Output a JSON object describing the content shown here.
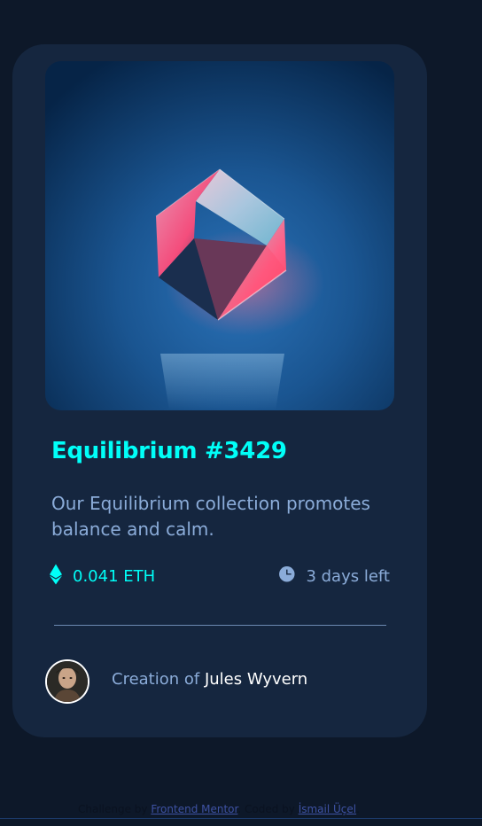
{
  "card": {
    "title": "Equilibrium #3429",
    "description": "Our Equilibrium collection promotes balance and calm.",
    "price": "0.041 ETH",
    "time_left": "3 days left",
    "creator_prefix": "Creation of",
    "creator_name": "Jules Wyvern"
  },
  "attribution": {
    "challenge_prefix": "Challenge by",
    "challenge_link": "Frontend Mentor",
    "separator": ". Coded by",
    "author_link": "İsmail Üçel",
    "suffix": "."
  },
  "icons": {
    "price": "ethereum-icon",
    "time": "clock-icon"
  },
  "colors": {
    "background": "#0d1829",
    "card": "#15263f",
    "accent_cyan": "#00fff8",
    "soft_blue": "#8bacd9",
    "white": "#ffffff"
  }
}
